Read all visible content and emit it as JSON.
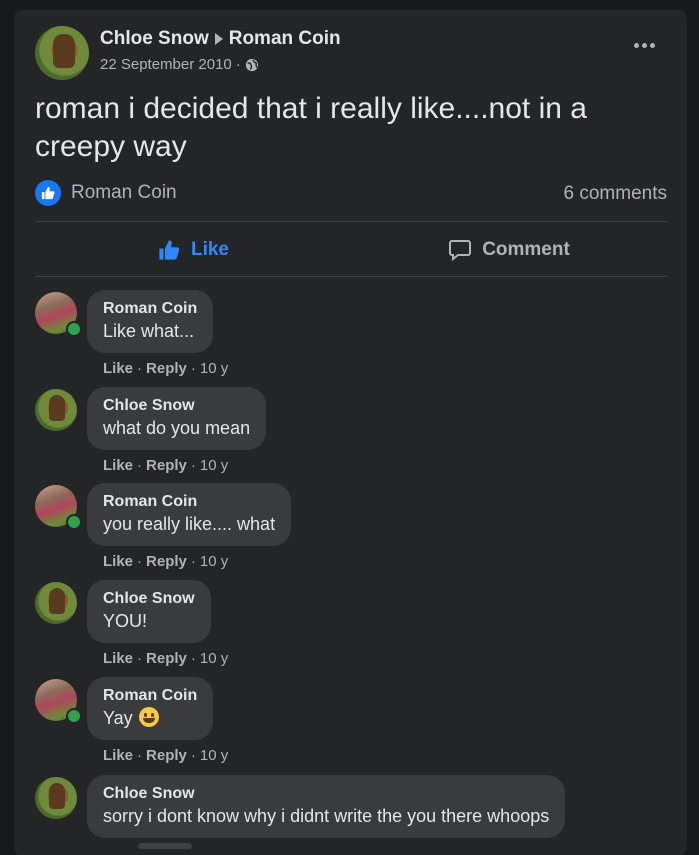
{
  "post": {
    "author": "Chloe Snow",
    "recipient": "Roman Coin",
    "date": "22 September 2010",
    "date_separator": "·",
    "text": "roman i decided that i really like....not in a creepy way",
    "reaction_user": "Roman Coin",
    "comments_count": "6 comments",
    "like_label": "Like",
    "comment_label": "Comment"
  },
  "comments": [
    {
      "name": "Roman Coin",
      "text": "Like what...",
      "like": "Like",
      "reply": "Reply",
      "time": "10 y"
    },
    {
      "name": "Chloe Snow",
      "text": "what do you mean",
      "like": "Like",
      "reply": "Reply",
      "time": "10 y"
    },
    {
      "name": "Roman Coin",
      "text": "you really like.... what",
      "like": "Like",
      "reply": "Reply",
      "time": "10 y"
    },
    {
      "name": "Chloe Snow",
      "text": "YOU!",
      "like": "Like",
      "reply": "Reply",
      "time": "10 y"
    },
    {
      "name": "Roman Coin",
      "text": "Yay",
      "like": "Like",
      "reply": "Reply",
      "time": "10 y"
    },
    {
      "name": "Chloe Snow",
      "text": "sorry i dont know why i didnt write the you there whoops"
    }
  ],
  "colors": {
    "accent": "#2d88ff",
    "online": "#31a24c",
    "badge": "#1877f2"
  }
}
